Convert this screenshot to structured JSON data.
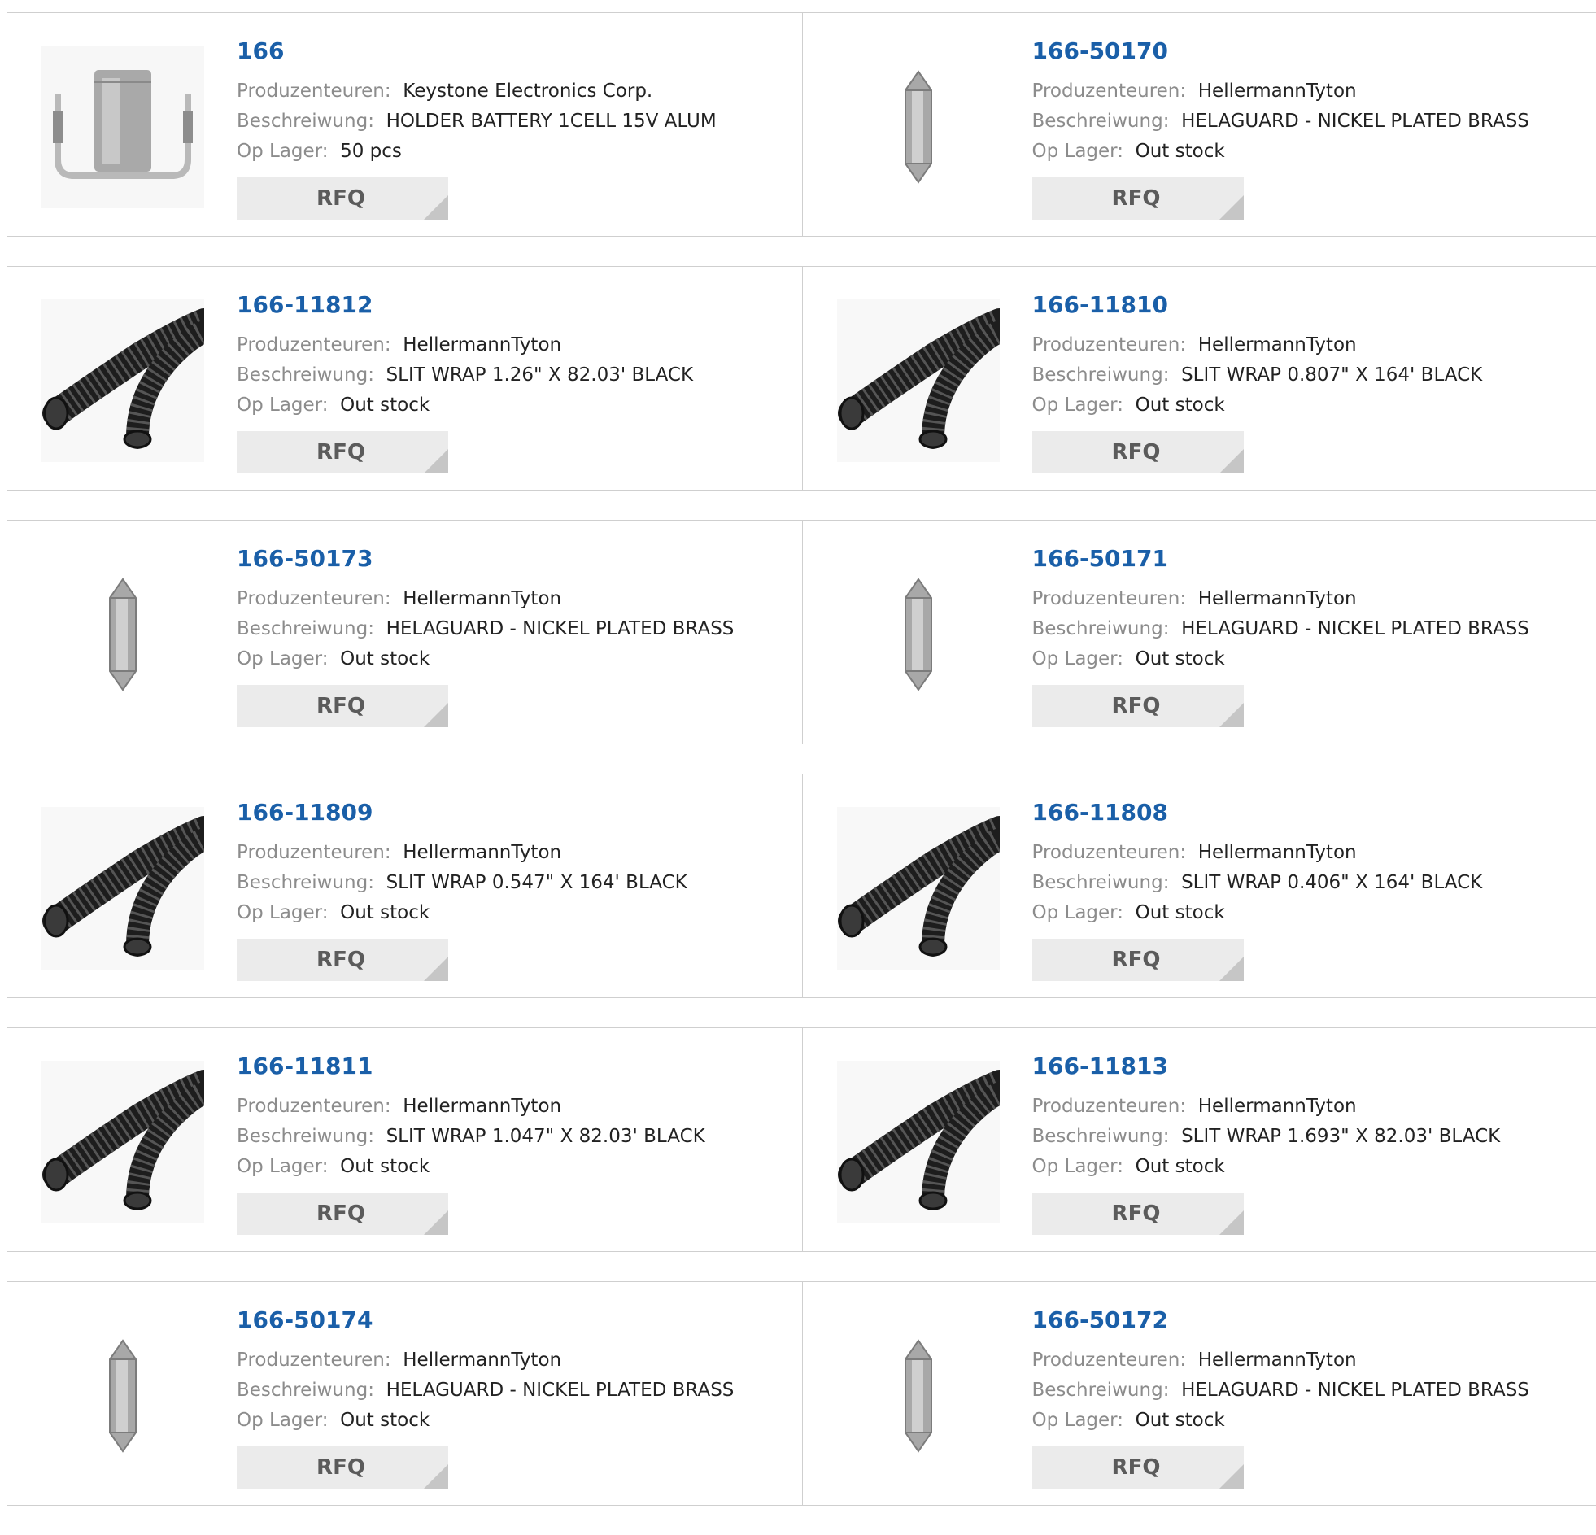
{
  "labels": {
    "manufacturer": "Produzenteuren:",
    "description": "Beschreiwung:",
    "stock": "Op Lager:",
    "rfq": "RFQ"
  },
  "products": [
    {
      "part": "166",
      "manufacturer": "Keystone Electronics Corp.",
      "description": "HOLDER BATTERY 1CELL 15V ALUM",
      "stock": "50 pcs",
      "image": "battery-holder-icon"
    },
    {
      "part": "166-50170",
      "manufacturer": "HellermannTyton",
      "description": "HELAGUARD - NICKEL PLATED BRASS",
      "stock": "Out stock",
      "image": "hex-nut-icon"
    },
    {
      "part": "166-11812",
      "manufacturer": "HellermannTyton",
      "description": "SLIT WRAP 1.26\" X 82.03' BLACK",
      "stock": "Out stock",
      "image": "slit-wrap-tubing-icon"
    },
    {
      "part": "166-11810",
      "manufacturer": "HellermannTyton",
      "description": "SLIT WRAP 0.807\" X 164' BLACK",
      "stock": "Out stock",
      "image": "slit-wrap-tubing-icon"
    },
    {
      "part": "166-50173",
      "manufacturer": "HellermannTyton",
      "description": "HELAGUARD - NICKEL PLATED BRASS",
      "stock": "Out stock",
      "image": "hex-nut-icon"
    },
    {
      "part": "166-50171",
      "manufacturer": "HellermannTyton",
      "description": "HELAGUARD - NICKEL PLATED BRASS",
      "stock": "Out stock",
      "image": "hex-nut-icon"
    },
    {
      "part": "166-11809",
      "manufacturer": "HellermannTyton",
      "description": "SLIT WRAP 0.547\" X 164' BLACK",
      "stock": "Out stock",
      "image": "slit-wrap-tubing-icon"
    },
    {
      "part": "166-11808",
      "manufacturer": "HellermannTyton",
      "description": "SLIT WRAP 0.406\" X 164' BLACK",
      "stock": "Out stock",
      "image": "slit-wrap-tubing-icon"
    },
    {
      "part": "166-11811",
      "manufacturer": "HellermannTyton",
      "description": "SLIT WRAP 1.047\" X 82.03' BLACK",
      "stock": "Out stock",
      "image": "slit-wrap-tubing-icon"
    },
    {
      "part": "166-11813",
      "manufacturer": "HellermannTyton",
      "description": "SLIT WRAP 1.693\" X 82.03' BLACK",
      "stock": "Out stock",
      "image": "slit-wrap-tubing-icon"
    },
    {
      "part": "166-50174",
      "manufacturer": "HellermannTyton",
      "description": "HELAGUARD - NICKEL PLATED BRASS",
      "stock": "Out stock",
      "image": "hex-nut-icon"
    },
    {
      "part": "166-50172",
      "manufacturer": "HellermannTyton",
      "description": "HELAGUARD - NICKEL PLATED BRASS",
      "stock": "Out stock",
      "image": "hex-nut-icon"
    }
  ],
  "colors": {
    "part_link": "#1a5fa8",
    "label_gray": "#8c8c8c",
    "value_text": "#222222",
    "rfq_bg": "#ebebeb",
    "rfq_text": "#5b5b5b",
    "border": "#cfcfcf"
  }
}
